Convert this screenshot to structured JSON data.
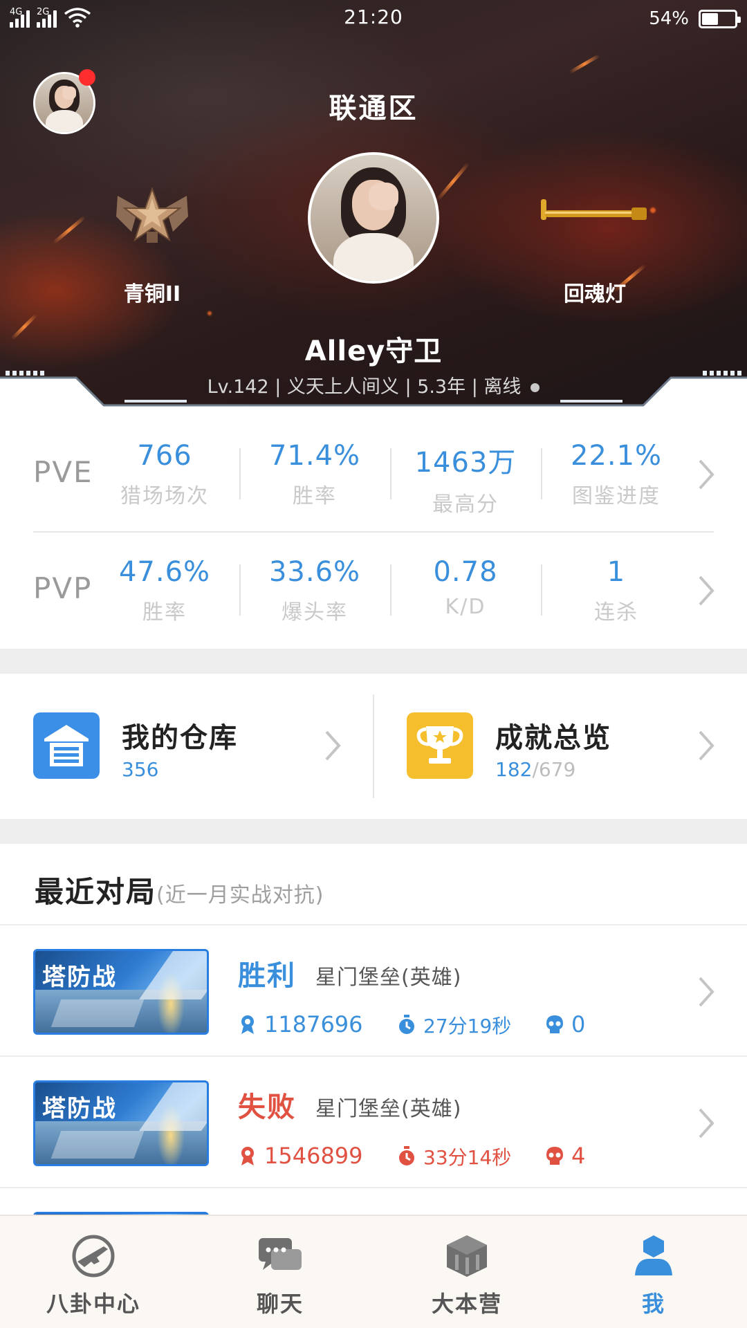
{
  "status_bar": {
    "network_1": "4G",
    "network_2": "2G",
    "time": "21:20",
    "battery_percent": "54%",
    "battery_level": 0.54
  },
  "profile": {
    "zone": "联通区",
    "rank": "青铜II",
    "weapon": "回魂灯",
    "username": "Alley守卫",
    "info_line": "Lv.142 | 义天上人间义 | 5.3年 | 离线",
    "has_notification": true
  },
  "stats": {
    "pve": {
      "label": "PVE",
      "items": [
        {
          "value": "766",
          "label": "猎场场次"
        },
        {
          "value": "71.4%",
          "label": "胜率"
        },
        {
          "value": "1463万",
          "label": "最高分"
        },
        {
          "value": "22.1%",
          "label": "图鉴进度"
        }
      ]
    },
    "pvp": {
      "label": "PVP",
      "items": [
        {
          "value": "47.6%",
          "label": "胜率"
        },
        {
          "value": "33.6%",
          "label": "爆头率"
        },
        {
          "value": "0.78",
          "label": "K/D"
        },
        {
          "value": "1",
          "label": "连杀"
        }
      ]
    }
  },
  "cards": {
    "warehouse": {
      "title": "我的仓库",
      "count": "356",
      "icon": "warehouse-icon",
      "color": "#3b8fe6"
    },
    "achievement": {
      "title": "成就总览",
      "done": "182",
      "total": "/679",
      "icon": "trophy-icon",
      "color": "#f4be2c"
    }
  },
  "recent": {
    "title": "最近对局",
    "hint": "(近一月实战对抗)",
    "matches": [
      {
        "mode": "塔防战",
        "result": "胜利",
        "map": "星门堡垒(英雄)",
        "score": "1187696",
        "duration": "27分19秒",
        "deaths": "0",
        "won": true
      },
      {
        "mode": "塔防战",
        "result": "失败",
        "map": "星门堡垒(英雄)",
        "score": "1546899",
        "duration": "33分14秒",
        "deaths": "4",
        "won": false
      }
    ]
  },
  "tabs": [
    {
      "label": "八卦中心",
      "icon": "gun-icon"
    },
    {
      "label": "聊天",
      "icon": "chat-icon"
    },
    {
      "label": "大本营",
      "icon": "base-icon"
    },
    {
      "label": "我",
      "icon": "profile-icon",
      "active": true
    }
  ],
  "colors": {
    "accent": "#3a8fdc",
    "loss": "#e05142",
    "muted": "#c9c9c9"
  }
}
